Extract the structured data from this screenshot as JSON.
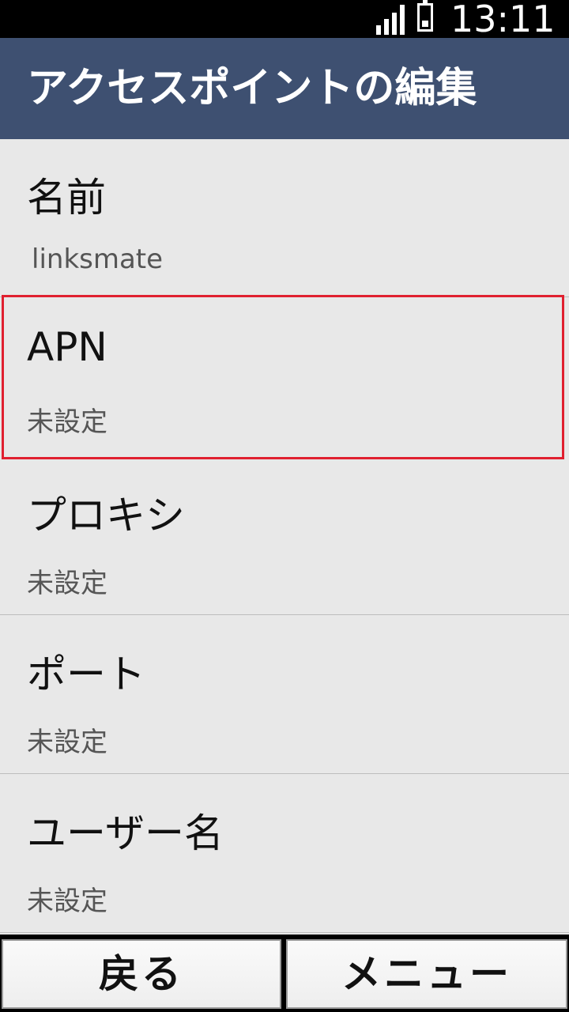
{
  "status_bar": {
    "time": "13:11",
    "signal_icon": "signal-bars-icon",
    "battery_icon": "battery-icon"
  },
  "header": {
    "title": "アクセスポイントの編集"
  },
  "settings": [
    {
      "label": "名前",
      "value": "linksmate"
    },
    {
      "label": "APN",
      "value": "未設定",
      "highlighted": true
    },
    {
      "label": "プロキシ",
      "value": "未設定"
    },
    {
      "label": "ポート",
      "value": "未設定"
    },
    {
      "label": "ユーザー名",
      "value": "未設定"
    }
  ],
  "softkeys": {
    "back_label": "戻る",
    "menu_label": "メニュー"
  },
  "colors": {
    "header_bg": "#3e5071",
    "highlight_border": "#e02030",
    "list_bg": "#e8e8e8"
  }
}
